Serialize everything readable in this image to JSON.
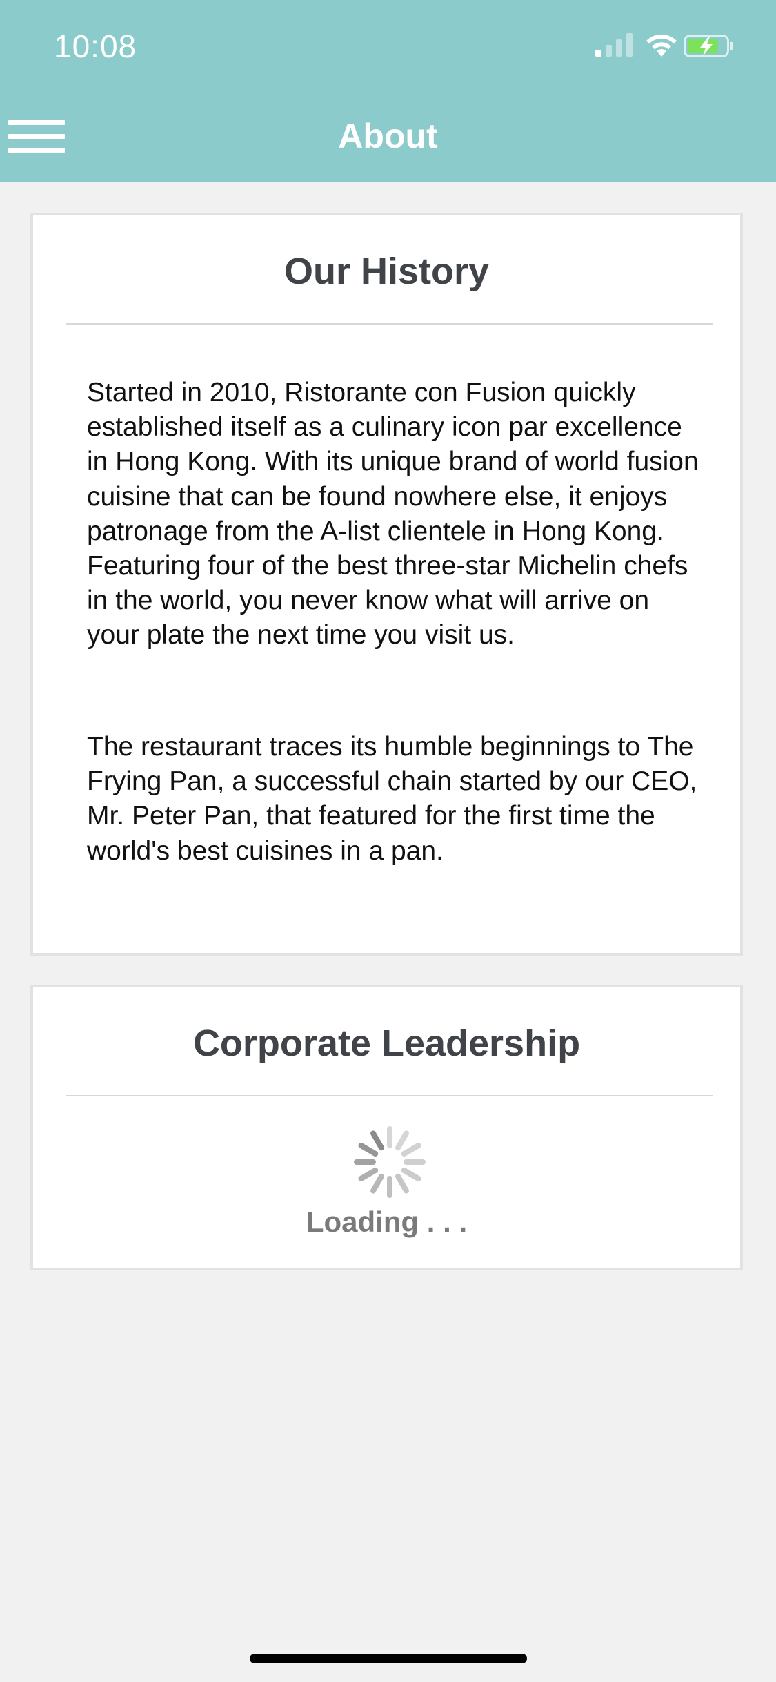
{
  "status_bar": {
    "time": "10:08"
  },
  "nav": {
    "title": "About",
    "menu_icon": "hamburger-menu-icon"
  },
  "history_card": {
    "title": "Our History",
    "paragraphs": [
      "Started in 2010, Ristorante con Fusion quickly established itself as a culinary icon par excellence in Hong Kong. With its unique brand of world fusion cuisine that can be found nowhere else, it enjoys patronage from the A-list clientele in Hong Kong.  Featuring four of the best three-star Michelin chefs in the world, you never know what will arrive on your plate the next time you visit us.",
      "The restaurant traces its humble beginnings to The Frying Pan, a successful chain started by our CEO, Mr. Peter Pan, that featured for the first time the world's best cuisines in a pan."
    ]
  },
  "leadership_card": {
    "title": "Corporate Leadership",
    "loading_text": "Loading . . ."
  },
  "colors": {
    "header_bg": "#8ccbcb",
    "page_bg": "#f1f1f1",
    "card_bg": "#ffffff",
    "title_text": "#404348",
    "loading_text": "#7a7a7a"
  }
}
